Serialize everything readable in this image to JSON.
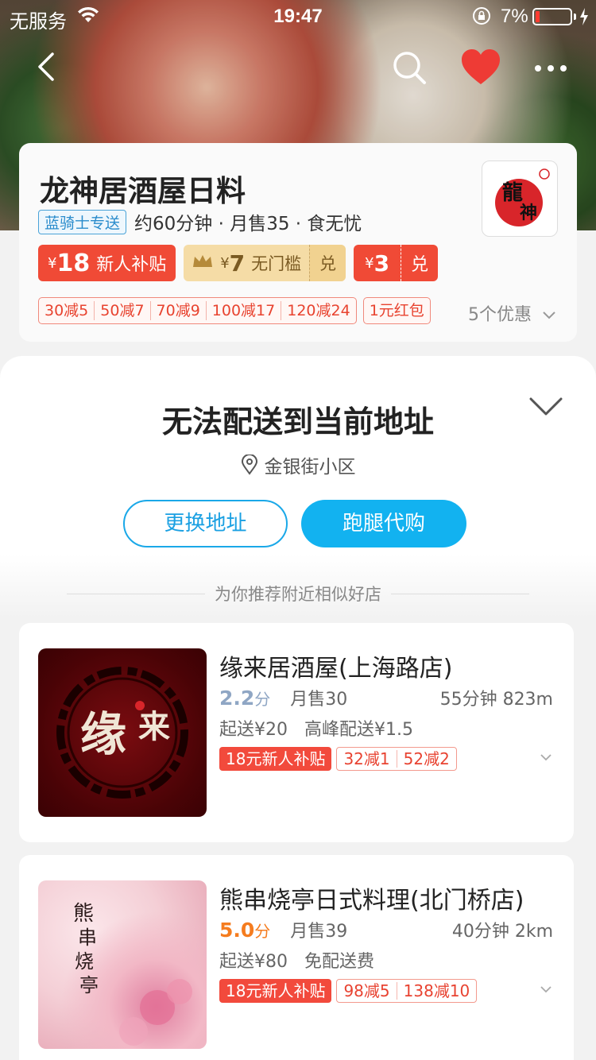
{
  "status_bar": {
    "carrier": "无服务",
    "time": "19:47",
    "battery_pct": "7%"
  },
  "store": {
    "name": "龙神居酒屋日料",
    "logo_text": "龍神",
    "delivery_tag": "蓝骑士专送",
    "meta": "约60分钟 · 月售35 · 食无忧",
    "promo1_yen": "¥",
    "promo1_amount": "18",
    "promo1_label": "新人补贴",
    "promo2_yen": "¥",
    "promo2_amount": "7",
    "promo2_label": "无门槛",
    "promo2_action": "兑",
    "promo3_yen": "¥",
    "promo3_amount": "3",
    "promo3_action": "兑",
    "discounts": [
      "30减5",
      "50减7",
      "70减9",
      "100减17",
      "120减24"
    ],
    "red_packet": "1元红包",
    "offers_count": "5个优惠"
  },
  "overlay": {
    "title": "无法配送到当前地址",
    "address": "金银街小区",
    "change_address": "更换地址",
    "errand_purchase": "跑腿代购",
    "recommend_heading": "为你推荐附近相似好店"
  },
  "shops": [
    {
      "name": "缘来居酒屋(上海路店)",
      "score": "2.2",
      "score_unit": "分",
      "monthly_sales": "月售30",
      "time_distance": "55分钟 823m",
      "min_order": "起送¥20",
      "delivery_fee": "高峰配送¥1.5",
      "new_user_tag": "18元新人补贴",
      "discounts": [
        "32减1",
        "52减2"
      ],
      "logo_text": "缘来",
      "score_color": "#8fa6c4"
    },
    {
      "name": "熊串烧亭日式料理(北门桥店)",
      "score": "5.0",
      "score_unit": "分",
      "monthly_sales": "月售39",
      "time_distance": "40分钟 2km",
      "min_order": "起送¥80",
      "delivery_fee": "免配送费",
      "new_user_tag": "18元新人补贴",
      "discounts": [
        "98减5",
        "138减10"
      ],
      "logo_text": "熊串烧亭",
      "score_color": "#f57c1f"
    }
  ],
  "colors": {
    "accent_blue": "#12b2f0",
    "promo_red": "#f04a36",
    "heart_red": "#ee3b35"
  }
}
